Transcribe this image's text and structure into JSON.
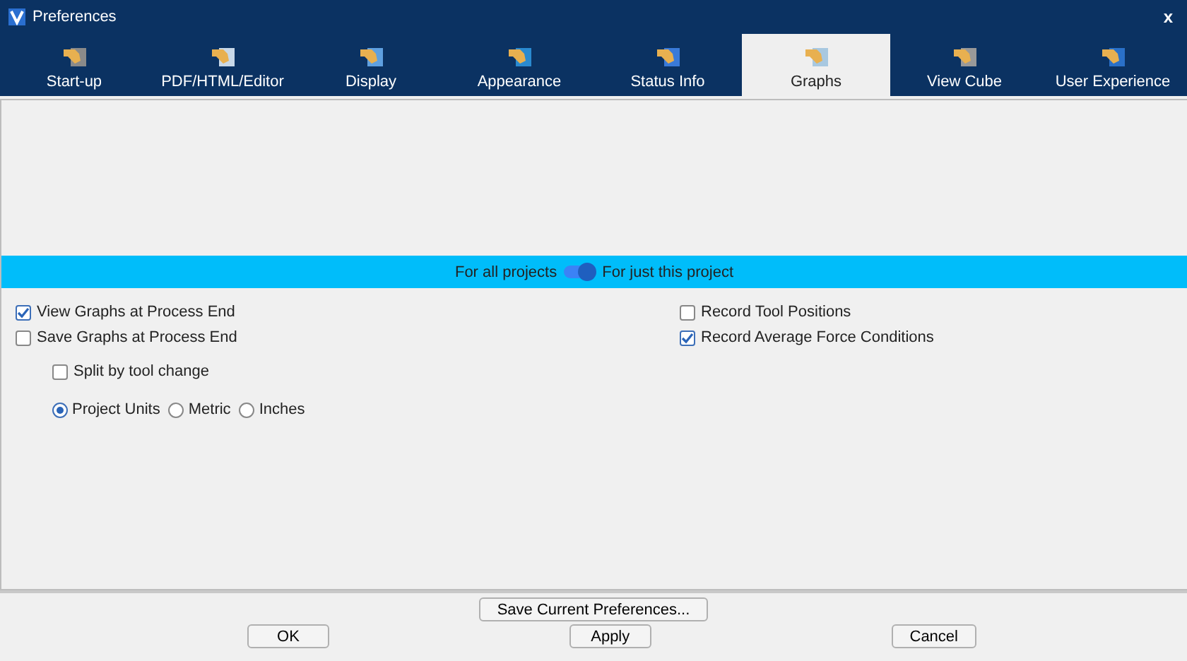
{
  "window": {
    "title": "Preferences",
    "close": "x"
  },
  "tabs": [
    {
      "label": "Start-up",
      "selected": false
    },
    {
      "label": "PDF/HTML/Editor",
      "selected": false
    },
    {
      "label": "Display",
      "selected": false
    },
    {
      "label": "Appearance",
      "selected": false
    },
    {
      "label": "Status Info",
      "selected": false
    },
    {
      "label": "Graphs",
      "selected": true
    },
    {
      "label": "View Cube",
      "selected": false
    },
    {
      "label": "User Experience",
      "selected": false
    }
  ],
  "scope": {
    "left_label": "For all projects",
    "right_label": "For just this project",
    "on": true
  },
  "left_options": [
    {
      "label": "View Graphs at Process End",
      "checked": true,
      "indented": false
    },
    {
      "label": "Save Graphs at Process End",
      "checked": false,
      "indented": false
    },
    {
      "label": "Split by tool change",
      "checked": false,
      "indented": true
    }
  ],
  "units": [
    {
      "label": "Project Units",
      "selected": true
    },
    {
      "label": "Metric",
      "selected": false
    },
    {
      "label": "Inches",
      "selected": false
    }
  ],
  "right_options": [
    {
      "label": "Record Tool Positions",
      "checked": false
    },
    {
      "label": "Record Average Force Conditions",
      "checked": true
    }
  ],
  "save_button": "Save Current Preferences...",
  "buttons": [
    "OK",
    "Apply",
    "Cancel"
  ]
}
